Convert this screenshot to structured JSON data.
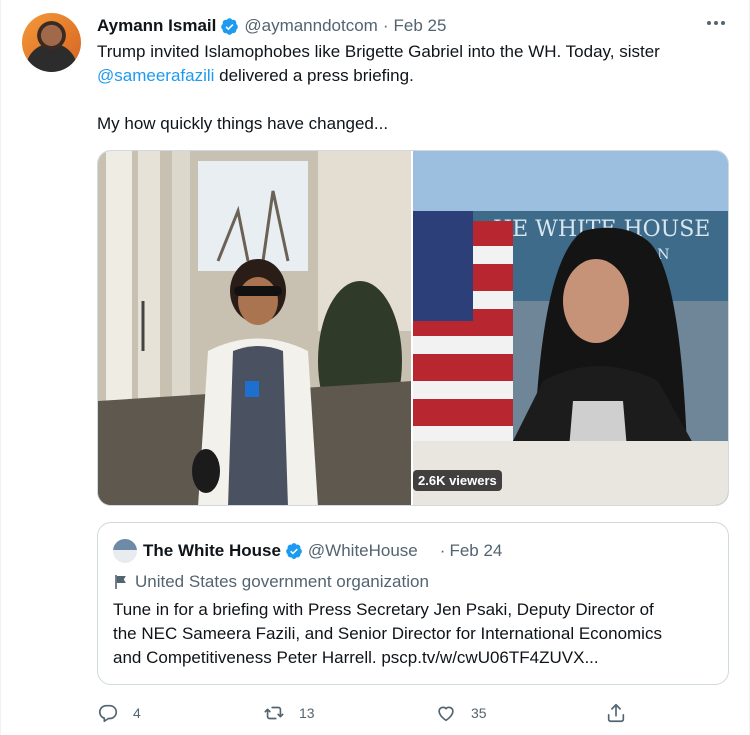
{
  "tweet": {
    "author_name": "Aymann Ismail",
    "handle": "@aymanndotcom",
    "separator": "·",
    "date": "Feb 25",
    "text_line1": "Trump invited Islamophobes like Brigette Gabriel into the WH. Today, sister",
    "mention": "@sameerafazili",
    "text_line2_rest": " delivered a press briefing.",
    "text_line3": "My how quickly things have changed..."
  },
  "media": {
    "viewers_badge": "2.6K viewers"
  },
  "quoted": {
    "author_name": "The White House",
    "handle": "@WhiteHouse",
    "separator": "·",
    "date": "Feb 24",
    "label": "United States government organization",
    "text_line1": "Tune in for a briefing with Press Secretary Jen Psaki, Deputy Director of",
    "text_line2": "the NEC Sameera Fazili, and Senior Director for International Economics",
    "text_line3": "and Competitiveness Peter Harrell. pscp.tv/w/cwU06TF4ZUVX..."
  },
  "actions": {
    "reply_count": "4",
    "retweet_count": "13",
    "like_count": "35"
  },
  "colors": {
    "accent": "#1d9bf0",
    "secondary_text": "#536471",
    "border": "#cfd9de"
  },
  "icons": [
    "verified-badge-icon",
    "more-options-icon",
    "government-flag-icon",
    "reply-icon",
    "retweet-icon",
    "like-icon",
    "share-icon"
  ]
}
